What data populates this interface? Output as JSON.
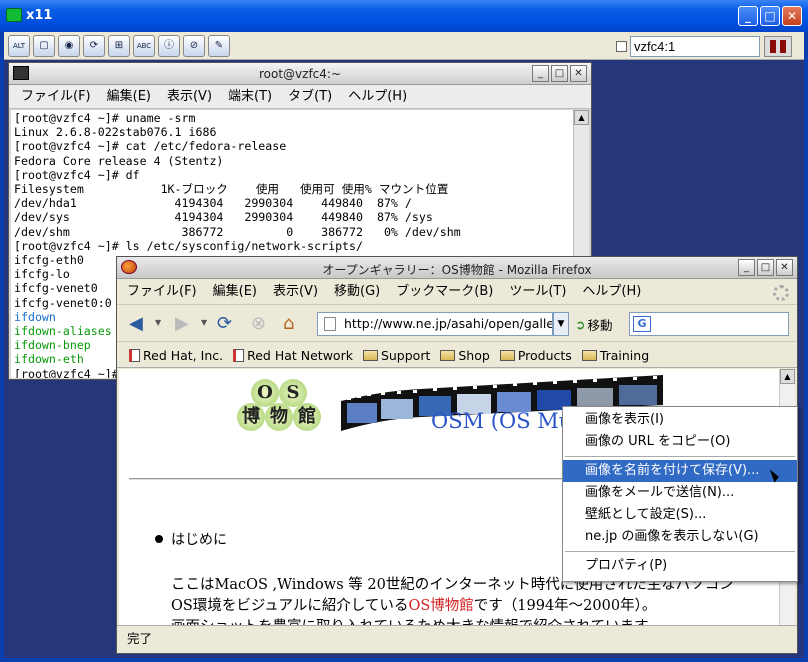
{
  "x11": {
    "title": "x11",
    "display_value": "vzfc4:1",
    "toolbar_icons": [
      "alt-icon",
      "window-icon",
      "network-icon",
      "refresh-icon",
      "windows-flag-icon",
      "abc-icon",
      "info-icon",
      "disconnect-icon",
      "clipboard-icon"
    ]
  },
  "terminal": {
    "title": "root@vzfc4:~",
    "menu": [
      "ファイル(F)",
      "編集(E)",
      "表示(V)",
      "端末(T)",
      "タブ(T)",
      "ヘルプ(H)"
    ],
    "lines": [
      {
        "text": "[root@vzfc4 ~]# uname -srm",
        "color": "normal"
      },
      {
        "text": "Linux 2.6.8-022stab076.1 i686",
        "color": "normal"
      },
      {
        "text": "[root@vzfc4 ~]# cat /etc/fedora-release",
        "color": "normal"
      },
      {
        "text": "Fedora Core release 4 (Stentz)",
        "color": "normal"
      },
      {
        "text": "[root@vzfc4 ~]# df",
        "color": "normal"
      },
      {
        "text": "Filesystem           1K-ブロック    使用   使用可 使用% マウント位置",
        "color": "normal"
      },
      {
        "text": "/dev/hda1              4194304   2990304    449840  87% /",
        "color": "normal"
      },
      {
        "text": "/dev/sys               4194304   2990304    449840  87% /sys",
        "color": "normal"
      },
      {
        "text": "/dev/shm                386772         0    386772   0% /dev/shm",
        "color": "normal"
      },
      {
        "text": "[root@vzfc4 ~]# ls /etc/sysconfig/network-scripts/",
        "color": "normal"
      },
      {
        "text": "ifcfg-eth0",
        "color": "normal"
      },
      {
        "text": "ifcfg-lo",
        "color": "normal"
      },
      {
        "text": "ifcfg-venet0",
        "color": "normal"
      },
      {
        "text": "ifcfg-venet0:0",
        "color": "normal"
      },
      {
        "text": "ifdown",
        "color": "blue"
      },
      {
        "text": "ifdown-aliases",
        "color": "green"
      },
      {
        "text": "ifdown-bnep",
        "color": "green"
      },
      {
        "text": "ifdown-eth",
        "color": "green"
      },
      {
        "text": "[root@vzfc4 ~]#",
        "color": "normal"
      }
    ]
  },
  "firefox": {
    "title": "オープンギャラリー：OS博物館 - Mozilla Firefox",
    "menu": [
      "ファイル(F)",
      "編集(E)",
      "表示(V)",
      "移動(G)",
      "ブックマーク(B)",
      "ツール(T)",
      "ヘルプ(H)"
    ],
    "url": "http://www.ne.jp/asahi/open/gallery/",
    "go_label": "移動",
    "bookmarks": [
      {
        "label": "Red Hat, Inc.",
        "kind": "page"
      },
      {
        "label": "Red Hat Network",
        "kind": "page"
      },
      {
        "label": "Support",
        "kind": "folder"
      },
      {
        "label": "Shop",
        "kind": "folder"
      },
      {
        "label": "Products",
        "kind": "folder"
      },
      {
        "label": "Training",
        "kind": "folder"
      }
    ],
    "page": {
      "logo_top": [
        "O",
        "S"
      ],
      "logo_bottom": [
        "博",
        "物",
        "館"
      ],
      "osm_title": "OSM (OS Museum)",
      "bullet": "はじめに",
      "para_line1": "ここはMacOS ,Windows 等 20世紀のインターネット時代に使用された主なパソコン",
      "para_line2_a": "OS環境をビジュアルに紹介している",
      "para_line2_link": "OS博物館",
      "para_line2_b": "です（1994年～2000年）。",
      "para_line3": "画面ショットを豊富に取り入れているため大きな情報で紹介されています。"
    },
    "status": "完了"
  },
  "context_menu": {
    "items": [
      {
        "label": "画像を表示(I)",
        "highlighted": false
      },
      {
        "label": "画像の URL をコピー(O)",
        "highlighted": false
      },
      {
        "label": "画像を名前を付けて保存(V)...",
        "highlighted": true
      },
      {
        "label": "画像をメールで送信(N)...",
        "highlighted": false
      },
      {
        "label": "壁紙として設定(S)...",
        "highlighted": false
      },
      {
        "label": "ne.jp の画像を表示しない(G)",
        "highlighted": false
      },
      {
        "label": "プロパティ(P)",
        "highlighted": false
      }
    ]
  }
}
